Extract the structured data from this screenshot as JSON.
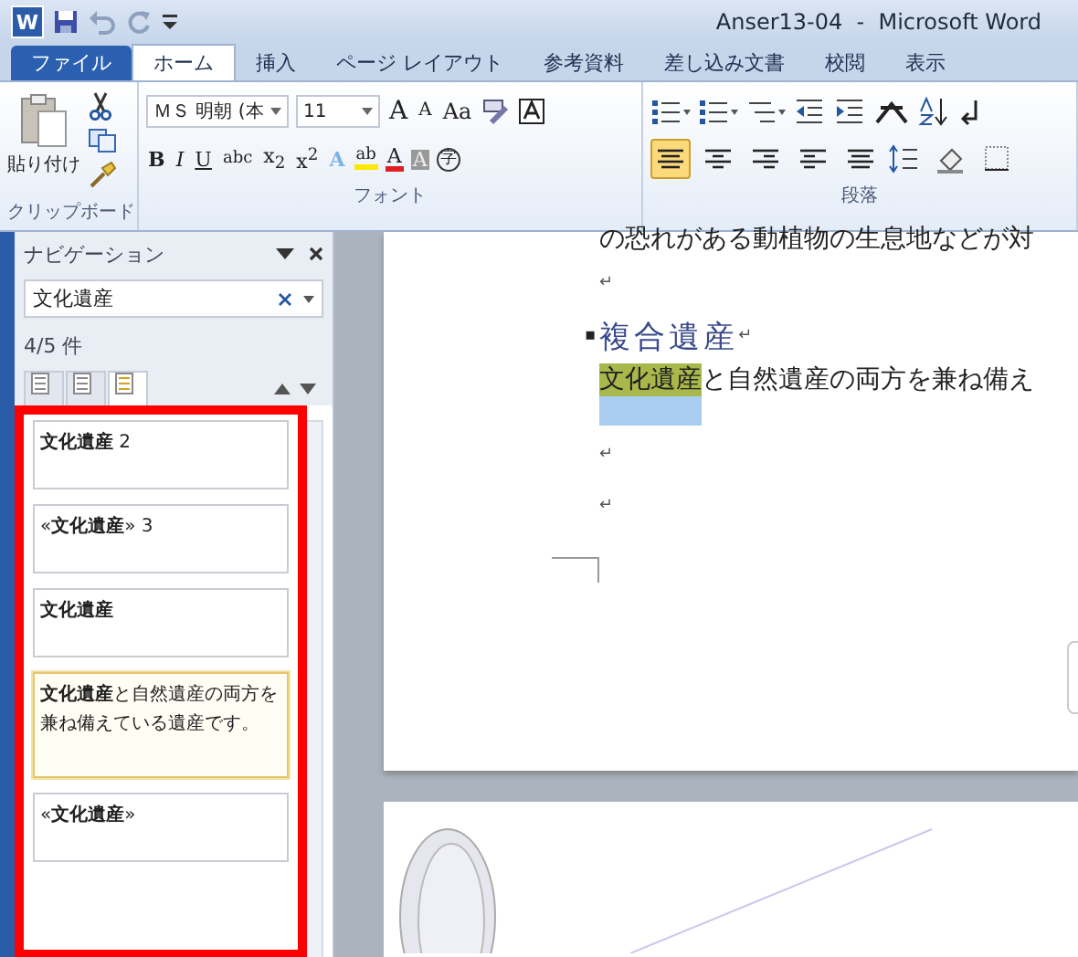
{
  "window": {
    "logo": "W",
    "title": "Anser13-04  -  Microsoft Word"
  },
  "tabs": [
    {
      "kind": "file",
      "label": "ファイル",
      "selected": false
    },
    {
      "kind": "tab",
      "label": "ホーム",
      "selected": true
    },
    {
      "kind": "tab",
      "label": "挿入",
      "selected": false
    },
    {
      "kind": "tab",
      "label": "ページ レイアウト",
      "selected": false
    },
    {
      "kind": "tab",
      "label": "参考資料",
      "selected": false
    },
    {
      "kind": "tab",
      "label": "差し込み文書",
      "selected": false
    },
    {
      "kind": "tab",
      "label": "校閲",
      "selected": false
    },
    {
      "kind": "tab",
      "label": "表示",
      "selected": false
    }
  ],
  "ribbon": {
    "clipboard": {
      "paste_label": "貼り付け",
      "group_label": "クリップボード"
    },
    "font": {
      "name": "ＭＳ 明朝 (本",
      "size": "11",
      "group_label": "フォント",
      "row1": [
        {
          "kind": "grow",
          "label": "A"
        },
        {
          "kind": "shrink",
          "label": "A"
        },
        {
          "kind": "case",
          "label": "Aa"
        }
      ],
      "row2": [
        {
          "kind": "bold",
          "label": "B"
        },
        {
          "kind": "italic",
          "label": "I"
        },
        {
          "kind": "underline",
          "label": "U"
        },
        {
          "kind": "strike",
          "label": "abc"
        },
        {
          "kind": "sub",
          "label": "x$_{2}$"
        },
        {
          "kind": "sup",
          "label": "x$^{2}$"
        },
        {
          "kind": "effect",
          "label": "A"
        },
        {
          "kind": "highlight",
          "label": "ab"
        },
        {
          "kind": "color",
          "label": "A"
        },
        {
          "kind": "shade",
          "label": "A"
        },
        {
          "kind": "enclose",
          "label": "字"
        }
      ]
    },
    "paragraph": {
      "group_label": "段落",
      "align": [
        {
          "selected": true
        },
        {
          "selected": false
        },
        {
          "selected": false
        },
        {
          "selected": false
        },
        {
          "selected": false
        }
      ]
    }
  },
  "navigation": {
    "title": "ナビゲーション",
    "search": {
      "value": "文化遺産"
    },
    "count": "4/5 件",
    "views": [
      {
        "selected": false
      },
      {
        "selected": false
      },
      {
        "selected": true
      }
    ],
    "results": [
      {
        "text": "**文化遺産** 2",
        "selected": false
      },
      {
        "text": "«**文化遺産**» 3",
        "selected": false
      },
      {
        "text": "**文化遺産**",
        "selected": false
      },
      {
        "text": "**文化遺産**と自然遺産の両方を兼ね備えている遺産です。",
        "selected": true
      },
      {
        "text": "«**文化遺産**»",
        "selected": false
      }
    ]
  },
  "document": {
    "lines": [
      {
        "kind": "text",
        "text": "の恐れがある動植物の生息地などが対"
      },
      {
        "kind": "mark",
        "text": "↵"
      },
      {
        "kind": "heading",
        "bullet": "▪",
        "text": "複合遺産",
        "mark": "↵"
      },
      {
        "kind": "match",
        "highlight": "文化遺産",
        "text": "と自然遺産の両方を兼ね備え"
      },
      {
        "kind": "mark",
        "text": "↵"
      },
      {
        "kind": "mark",
        "text": "↵"
      }
    ]
  }
}
